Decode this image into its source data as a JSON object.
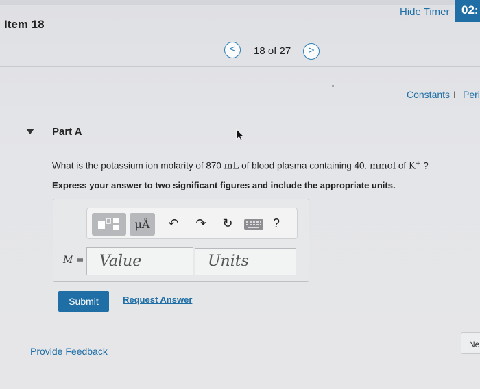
{
  "header": {
    "item_title": "Item 18",
    "hide_timer": "Hide Timer",
    "timer": "02:"
  },
  "pager": {
    "prev_glyph": "<",
    "position": "18 of 27",
    "next_glyph": ">"
  },
  "resources": {
    "constants": "Constants",
    "separator": "I",
    "periodic": "Peri"
  },
  "part": {
    "title": "Part A",
    "question_prefix": "What is the potassium ion molarity of 870 ",
    "question_unit1": "mL",
    "question_mid": " of blood plasma containing 40. ",
    "question_unit2": "mmol",
    "question_of": " of ",
    "question_ion": "K",
    "question_charge": "+",
    "question_suffix": " ?",
    "instruction": "Express your answer to two significant figures and include the appropriate units."
  },
  "answer": {
    "variable_label": "M =",
    "value_placeholder": "Value",
    "units_placeholder": "Units",
    "toolbar": {
      "units_glyph": "μÅ",
      "undo_glyph": "↶",
      "redo_glyph": "↷",
      "reset_glyph": "↻",
      "help_glyph": "?",
      "icons": [
        "templates-icon",
        "units-icon",
        "undo-icon",
        "redo-icon",
        "reset-icon",
        "keyboard-icon",
        "help-icon"
      ]
    }
  },
  "actions": {
    "submit": "Submit",
    "request_answer": "Request Answer",
    "feedback": "Provide Feedback",
    "next": "Ne"
  },
  "colors": {
    "accent": "#1f6fa6",
    "background": "#e4e5e8"
  }
}
